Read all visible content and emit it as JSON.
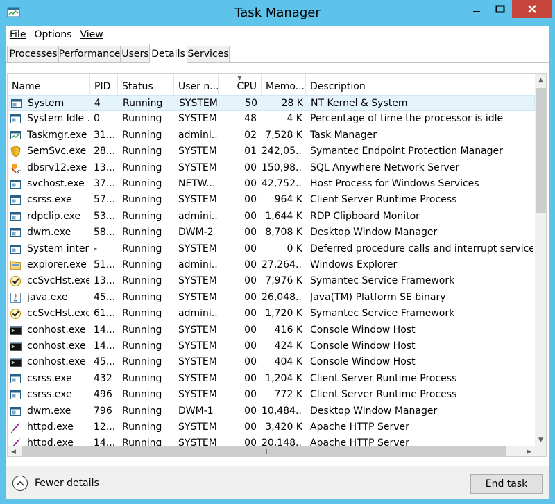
{
  "window": {
    "title": "Task Manager",
    "accent": "#5dc3eb",
    "close_color": "#c7463b"
  },
  "menu": [
    "File",
    "Options",
    "View"
  ],
  "tabs": [
    "Processes",
    "Performance",
    "Users",
    "Details",
    "Services"
  ],
  "active_tab": "Details",
  "columns": [
    "Name",
    "PID",
    "Status",
    "User n...",
    "CPU",
    "Memo...",
    "Description"
  ],
  "sorted_column": "CPU",
  "rows": [
    {
      "name": "System",
      "pid": "4",
      "status": "Running",
      "user": "SYSTEM",
      "cpu": "50",
      "mem": "28 K",
      "desc": "NT Kernel & System",
      "icon": "window-icon"
    },
    {
      "name": "System Idle ...",
      "pid": "0",
      "status": "Running",
      "user": "SYSTEM",
      "cpu": "48",
      "mem": "4 K",
      "desc": "Percentage of time the processor is idle",
      "icon": "window-icon"
    },
    {
      "name": "Taskmgr.exe",
      "pid": "31...",
      "status": "Running",
      "user": "admini...",
      "cpu": "02",
      "mem": "7,528 K",
      "desc": "Task Manager",
      "icon": "taskmgr-icon"
    },
    {
      "name": "SemSvc.exe",
      "pid": "28...",
      "status": "Running",
      "user": "SYSTEM",
      "cpu": "01",
      "mem": "242,05...",
      "desc": "Symantec Endpoint Protection Manager",
      "icon": "shield-icon"
    },
    {
      "name": "dbsrv12.exe",
      "pid": "13...",
      "status": "Running",
      "user": "SYSTEM",
      "cpu": "00",
      "mem": "150,98...",
      "desc": "SQL Anywhere Network Server",
      "icon": "database-icon"
    },
    {
      "name": "svchost.exe",
      "pid": "37...",
      "status": "Running",
      "user": "NETW...",
      "cpu": "00",
      "mem": "42,752...",
      "desc": "Host Process for Windows Services",
      "icon": "window-icon"
    },
    {
      "name": "csrss.exe",
      "pid": "57...",
      "status": "Running",
      "user": "SYSTEM",
      "cpu": "00",
      "mem": "964 K",
      "desc": "Client Server Runtime Process",
      "icon": "window-icon"
    },
    {
      "name": "rdpclip.exe",
      "pid": "53...",
      "status": "Running",
      "user": "admini...",
      "cpu": "00",
      "mem": "1,644 K",
      "desc": "RDP Clipboard Monitor",
      "icon": "window-icon"
    },
    {
      "name": "dwm.exe",
      "pid": "58...",
      "status": "Running",
      "user": "DWM-2",
      "cpu": "00",
      "mem": "8,708 K",
      "desc": "Desktop Window Manager",
      "icon": "window-icon"
    },
    {
      "name": "System inter...",
      "pid": "-",
      "status": "Running",
      "user": "SYSTEM",
      "cpu": "00",
      "mem": "0 K",
      "desc": "Deferred procedure calls and interrupt service routi",
      "icon": "window-icon"
    },
    {
      "name": "explorer.exe",
      "pid": "51...",
      "status": "Running",
      "user": "admini...",
      "cpu": "00",
      "mem": "27,264...",
      "desc": "Windows Explorer",
      "icon": "folder-icon"
    },
    {
      "name": "ccSvcHst.exe",
      "pid": "13...",
      "status": "Running",
      "user": "SYSTEM",
      "cpu": "00",
      "mem": "7,976 K",
      "desc": "Symantec Service Framework",
      "icon": "checkmark-icon"
    },
    {
      "name": "java.exe",
      "pid": "45...",
      "status": "Running",
      "user": "SYSTEM",
      "cpu": "00",
      "mem": "26,048...",
      "desc": "Java(TM) Platform SE binary",
      "icon": "java-icon"
    },
    {
      "name": "ccSvcHst.exe",
      "pid": "61...",
      "status": "Running",
      "user": "admini...",
      "cpu": "00",
      "mem": "1,720 K",
      "desc": "Symantec Service Framework",
      "icon": "checkmark-icon"
    },
    {
      "name": "conhost.exe",
      "pid": "14...",
      "status": "Running",
      "user": "SYSTEM",
      "cpu": "00",
      "mem": "416 K",
      "desc": "Console Window Host",
      "icon": "console-icon"
    },
    {
      "name": "conhost.exe",
      "pid": "14...",
      "status": "Running",
      "user": "SYSTEM",
      "cpu": "00",
      "mem": "424 K",
      "desc": "Console Window Host",
      "icon": "console-icon"
    },
    {
      "name": "conhost.exe",
      "pid": "45...",
      "status": "Running",
      "user": "SYSTEM",
      "cpu": "00",
      "mem": "404 K",
      "desc": "Console Window Host",
      "icon": "console-icon"
    },
    {
      "name": "csrss.exe",
      "pid": "432",
      "status": "Running",
      "user": "SYSTEM",
      "cpu": "00",
      "mem": "1,204 K",
      "desc": "Client Server Runtime Process",
      "icon": "window-icon"
    },
    {
      "name": "csrss.exe",
      "pid": "496",
      "status": "Running",
      "user": "SYSTEM",
      "cpu": "00",
      "mem": "772 K",
      "desc": "Client Server Runtime Process",
      "icon": "window-icon"
    },
    {
      "name": "dwm.exe",
      "pid": "796",
      "status": "Running",
      "user": "DWM-1",
      "cpu": "00",
      "mem": "10,484...",
      "desc": "Desktop Window Manager",
      "icon": "window-icon"
    },
    {
      "name": "httpd.exe",
      "pid": "12...",
      "status": "Running",
      "user": "SYSTEM",
      "cpu": "00",
      "mem": "3,420 K",
      "desc": "Apache HTTP Server",
      "icon": "feather-icon"
    },
    {
      "name": "httpd.exe",
      "pid": "14...",
      "status": "Running",
      "user": "SYSTEM",
      "cpu": "00",
      "mem": "20,148...",
      "desc": "Apache HTTP Server",
      "icon": "feather-icon"
    }
  ],
  "footer": {
    "fewer_details": "Fewer details",
    "end_task": "End task"
  }
}
